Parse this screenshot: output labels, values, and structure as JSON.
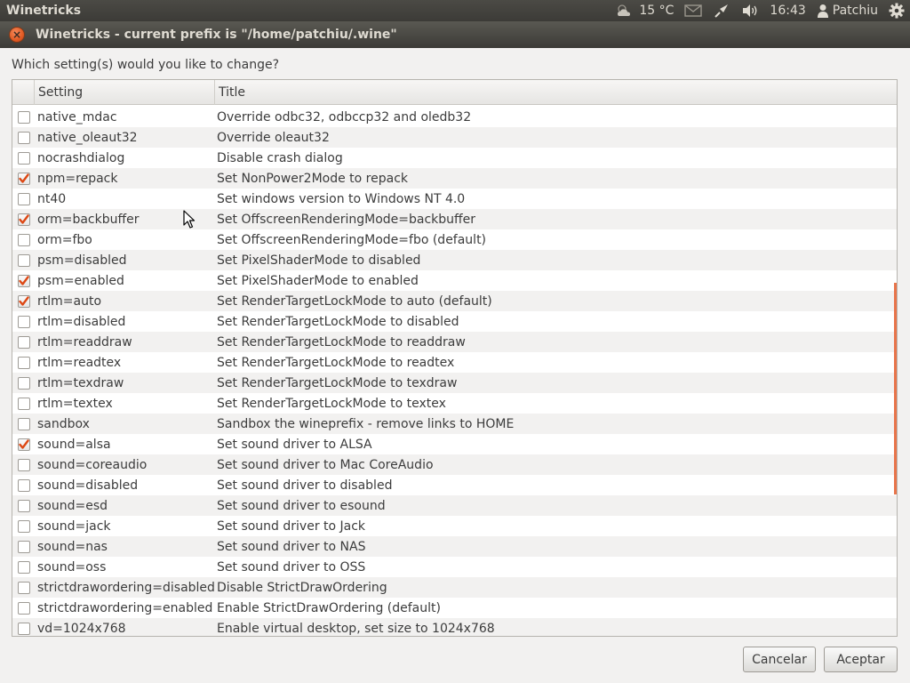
{
  "panel": {
    "app_name": "Winetricks",
    "temperature": "15 °C",
    "time": "16:43",
    "user": "Patchiu"
  },
  "window": {
    "title": "Winetricks - current prefix is \"/home/patchiu/.wine\""
  },
  "dialog": {
    "prompt": "Which setting(s) would you like to change?",
    "columns": {
      "setting": "Setting",
      "title": "Title"
    },
    "rows": [
      {
        "setting": "native_mdac",
        "title": "Override odbc32, odbccp32 and oledb32",
        "checked": false
      },
      {
        "setting": "native_oleaut32",
        "title": "Override oleaut32",
        "checked": false
      },
      {
        "setting": "nocrashdialog",
        "title": "Disable crash dialog",
        "checked": false
      },
      {
        "setting": "npm=repack",
        "title": "Set NonPower2Mode to repack",
        "checked": true
      },
      {
        "setting": "nt40",
        "title": "Set windows version to Windows NT 4.0",
        "checked": false
      },
      {
        "setting": "orm=backbuffer",
        "title": "Set OffscreenRenderingMode=backbuffer",
        "checked": true
      },
      {
        "setting": "orm=fbo",
        "title": "Set OffscreenRenderingMode=fbo (default)",
        "checked": false
      },
      {
        "setting": "psm=disabled",
        "title": "Set PixelShaderMode to disabled",
        "checked": false
      },
      {
        "setting": "psm=enabled",
        "title": "Set PixelShaderMode to enabled",
        "checked": true
      },
      {
        "setting": "rtlm=auto",
        "title": "Set RenderTargetLockMode to auto (default)",
        "checked": true
      },
      {
        "setting": "rtlm=disabled",
        "title": "Set RenderTargetLockMode to disabled",
        "checked": false
      },
      {
        "setting": "rtlm=readdraw",
        "title": "Set RenderTargetLockMode to readdraw",
        "checked": false
      },
      {
        "setting": "rtlm=readtex",
        "title": "Set RenderTargetLockMode to readtex",
        "checked": false
      },
      {
        "setting": "rtlm=texdraw",
        "title": "Set RenderTargetLockMode to texdraw",
        "checked": false
      },
      {
        "setting": "rtlm=textex",
        "title": "Set RenderTargetLockMode to textex",
        "checked": false
      },
      {
        "setting": "sandbox",
        "title": "Sandbox the wineprefix - remove links to HOME",
        "checked": false
      },
      {
        "setting": "sound=alsa",
        "title": "Set sound driver to ALSA",
        "checked": true
      },
      {
        "setting": "sound=coreaudio",
        "title": "Set sound driver to Mac CoreAudio",
        "checked": false
      },
      {
        "setting": "sound=disabled",
        "title": "Set sound driver to disabled",
        "checked": false
      },
      {
        "setting": "sound=esd",
        "title": "Set sound driver to esound",
        "checked": false
      },
      {
        "setting": "sound=jack",
        "title": "Set sound driver to Jack",
        "checked": false
      },
      {
        "setting": "sound=nas",
        "title": "Set sound driver to NAS",
        "checked": false
      },
      {
        "setting": "sound=oss",
        "title": "Set sound driver to OSS",
        "checked": false
      },
      {
        "setting": "strictdrawordering=disabled",
        "title": "Disable StrictDrawOrdering",
        "checked": false
      },
      {
        "setting": "strictdrawordering=enabled",
        "title": "Enable StrictDrawOrdering (default)",
        "checked": false
      },
      {
        "setting": "vd=1024x768",
        "title": "Enable virtual desktop, set size to 1024x768",
        "checked": false
      }
    ],
    "buttons": {
      "cancel": "Cancelar",
      "accept": "Aceptar"
    }
  },
  "icons": {
    "weather": "weather-cloudy-icon",
    "mail": "mail-icon",
    "network": "network-icon",
    "volume": "volume-icon",
    "user": "user-icon",
    "settings": "gear-icon",
    "close": "close-icon",
    "check": "checkmark-icon"
  },
  "colors": {
    "accent": "#e15a23",
    "panel_bg": "#3c3b37",
    "check": "#dd4814"
  }
}
